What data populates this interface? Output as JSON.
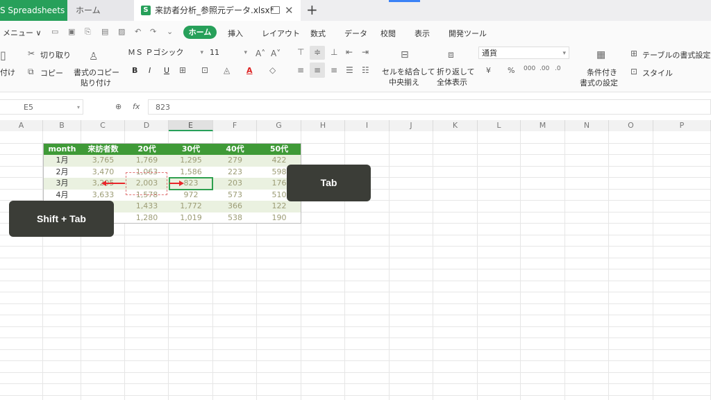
{
  "tabs": {
    "app_label": "S Spreadsheets",
    "home_label": "ホーム",
    "file_label": "来訪者分析_参照元データ.xlsx*",
    "file_icon_letter": "S",
    "new_tab": "+",
    "close": "✕"
  },
  "menu": {
    "menu_label": "メニュー ∨",
    "items": [
      "ホーム",
      "挿入",
      "レイアウト",
      "数式",
      "データ",
      "校閲",
      "表示",
      "開発ツール"
    ],
    "active_index": 0
  },
  "ribbon": {
    "paste_label": "付け",
    "cut_label": "切り取り",
    "copy_label": "コピー",
    "format_painter_line1": "書式のコピー",
    "format_painter_line2": "貼り付け",
    "font_name": "ＭＳ Ｐゴシック",
    "font_size": "11",
    "bold": "B",
    "italic": "I",
    "underline": "U",
    "font_color_glyph": "A",
    "merge_line1": "セルを結合して",
    "merge_line2": "中央揃え",
    "wrap_line1": "折り返して",
    "wrap_line2": "全体表示",
    "number_format": "通貨",
    "currency_glyph": "¥",
    "percent_glyph": "%",
    "cond_line1": "条件付き",
    "cond_line2": "書式の設定",
    "table_format_label": "テーブルの書式設定",
    "style_label": "スタイル"
  },
  "formula_bar": {
    "cell_ref": "E5",
    "fx": "fx",
    "value": "823"
  },
  "columns": [
    "A",
    "B",
    "C",
    "D",
    "E",
    "F",
    "G",
    "H",
    "I",
    "J",
    "K",
    "L",
    "M",
    "N",
    "O",
    "P"
  ],
  "selected_column": "E",
  "table": {
    "headers": [
      "month",
      "来訪者数",
      "20代",
      "30代",
      "40代",
      "50代"
    ],
    "rows": [
      [
        "1月",
        "3,765",
        "1,769",
        "1,295",
        "279",
        "422"
      ],
      [
        "2月",
        "3,470",
        "1,063",
        "1,586",
        "223",
        "598"
      ],
      [
        "3月",
        "3,205",
        "2,003",
        "823",
        "203",
        "176"
      ],
      [
        "4月",
        "3,633",
        "1,578",
        "972",
        "573",
        "510"
      ],
      [
        "",
        "",
        "1,433",
        "1,772",
        "366",
        "122"
      ],
      [
        "",
        "",
        "1,280",
        "1,019",
        "538",
        "190"
      ]
    ]
  },
  "annotations": {
    "tab_callout": "Tab",
    "shift_tab_callout": "Shift + Tab"
  },
  "colors": {
    "accent_green": "#27a05a",
    "table_header_green": "#3f9a37",
    "band_green": "#eaf1e0",
    "arrow_red": "#e8262a",
    "callout_bg": "#3b3d37"
  }
}
